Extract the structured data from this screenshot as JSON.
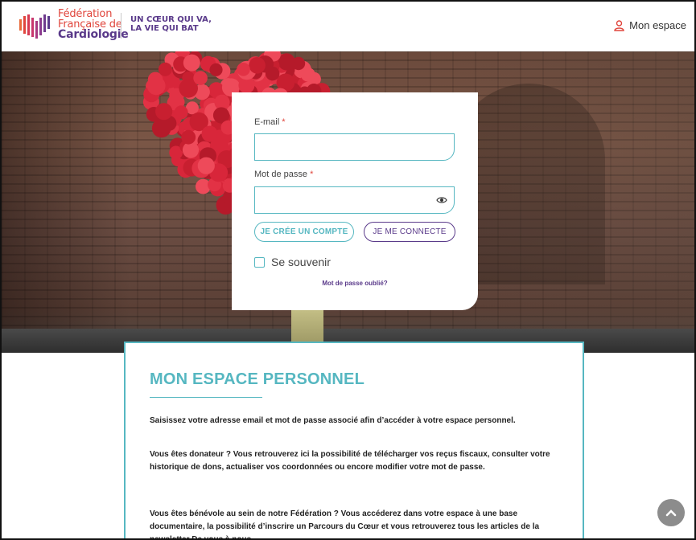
{
  "header": {
    "logo_line1": "Fédération",
    "logo_line2": "Française de",
    "logo_line3": "Cardiologie",
    "tagline_line1": "UN CŒUR QUI VA,",
    "tagline_line2": "LA VIE QUI BAT",
    "account_link": "Mon espace",
    "account_icon": "user-icon"
  },
  "login": {
    "email_label": "E-mail",
    "email_value": "",
    "password_label": "Mot de passe",
    "password_value": "",
    "required_mark": "*",
    "toggle_icon": "eye-icon",
    "create_account_button": "JE CRÉE UN COMPTE",
    "connect_button": "JE ME CONNECTE",
    "remember_label": "Se souvenir",
    "forgot_link": "Mot de passe oublié?"
  },
  "personal_space": {
    "title": "MON ESPACE PERSONNEL",
    "paragraphs": [
      "Saisissez votre adresse email et mot de passe associé afin d’accéder à votre espace personnel.",
      "Vous êtes donateur ? Vous retrouverez ici la possibilité de télécharger vos reçus fiscaux, consulter votre historique de dons, actualiser vos coordonnées ou encore modifier votre mot de passe.",
      "Vous êtes bénévole au sein de notre Fédération ? Vous accéderez dans votre espace à une base documentaire, la possibilité d’inscrire un Parcours du Cœur et vous retrouverez tous les articles de la newsletter De vous à nous."
    ]
  },
  "scroll_top_icon": "chevron-up-icon",
  "colors": {
    "teal": "#56b7c1",
    "purple": "#5a3a8a",
    "red": "#e0453c"
  }
}
